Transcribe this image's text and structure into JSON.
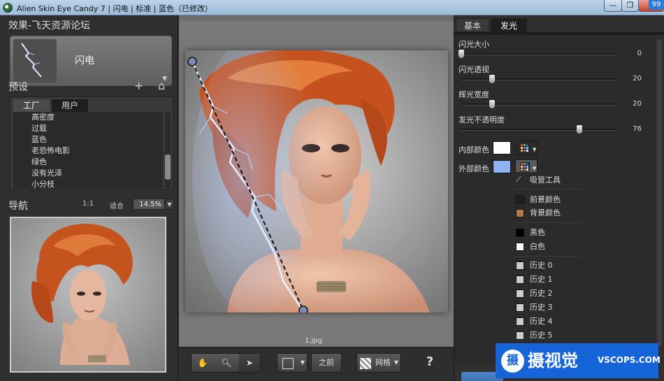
{
  "window": {
    "title": "Alien Skin Eye Candy 7 | 闪电 | 标准 | 蓝色（已修改）",
    "min_label": "—",
    "max_label": "❐",
    "close_label": "✕",
    "badge": "99"
  },
  "left_panel": {
    "effect_heading": "效果-飞天资源论坛",
    "effect_name": "闪电",
    "presets_heading": "预设",
    "add_icon": "+",
    "home_icon": "⌂",
    "preset_tabs": [
      "工厂",
      "用户"
    ],
    "preset_items": [
      "高密度",
      "过载",
      "蓝色",
      "老恐怖电影",
      "绿色",
      "没有光泽",
      "小分枝"
    ],
    "nav_heading": "导航",
    "zoom_1to1": "1:1",
    "zoom_fit": "适合",
    "zoom_value": "14.5%"
  },
  "canvas": {
    "filename": "1.jpg"
  },
  "toolbar": {
    "before_label": "之前",
    "grid_label": "网格",
    "help_label": "?"
  },
  "right_panel": {
    "tabs": [
      "基本",
      "发光"
    ],
    "active_tab": "发光",
    "params": [
      {
        "label": "闪光大小",
        "value": "0",
        "fraction": 0.0
      },
      {
        "label": "闪光透视",
        "value": "20",
        "fraction": 0.2
      },
      {
        "label": "辉光宽度",
        "value": "20",
        "fraction": 0.2
      },
      {
        "label": "发光不透明度",
        "value": "76",
        "fraction": 0.76
      }
    ],
    "inner_color_label": "内部颜色",
    "outer_color_label": "外部颜色",
    "inner_color": "#ffffff",
    "outer_color": "#8fb4f0",
    "color_menu": {
      "eyedropper": "吸管工具",
      "foreground": "前景颜色",
      "background": "背景颜色",
      "black": "黑色",
      "white": "白色",
      "history": [
        "历史 0",
        "历史 1",
        "历史 2",
        "历史 3",
        "历史 4",
        "历史 5"
      ],
      "foreground_color": "#222222",
      "background_color": "#b27a4a",
      "history_color": "#cccccc"
    }
  },
  "watermark": {
    "logo": "摄",
    "name": "摄视觉",
    "url": "VSCOPS.COM"
  }
}
